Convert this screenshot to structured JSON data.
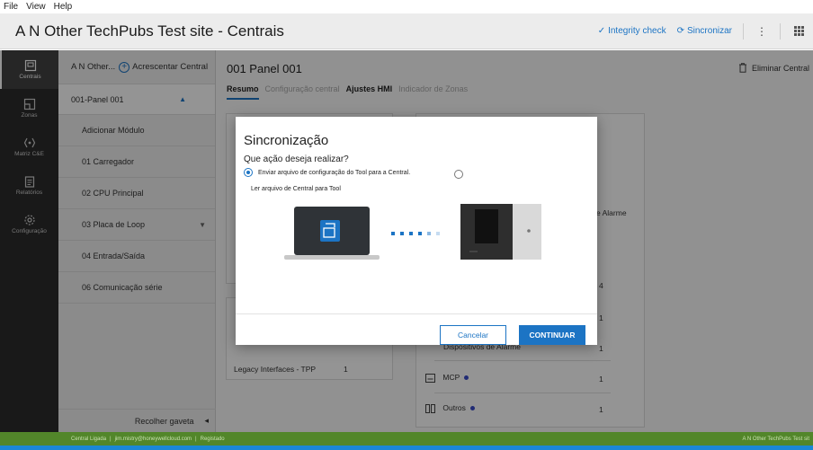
{
  "menubar": {
    "file": "File",
    "view": "View",
    "help": "Help"
  },
  "header": {
    "title": "A N Other TechPubs Test site -  Centrais",
    "integrity_check": "Integrity check",
    "sync": "Sincronizar"
  },
  "leftnav": {
    "items": [
      {
        "label": "Centrais",
        "icon": "panel-icon"
      },
      {
        "label": "Zonas",
        "icon": "zones-icon"
      },
      {
        "label": "Matriz C&E",
        "icon": "matrix-icon"
      },
      {
        "label": "Relatórios",
        "icon": "reports-icon"
      },
      {
        "label": "Configuração",
        "icon": "gear-icon"
      }
    ]
  },
  "drawer": {
    "site": "A N Other...",
    "add_panel": "Acrescentar Central",
    "panel": "001-Panel 001",
    "items": [
      "Adicionar Módulo",
      "01 Carregador",
      "02 CPU Principal",
      "03 Placa de Loop",
      "04 Entrada/Saída",
      "06 Comunicação série"
    ],
    "collapse": "Recolher gaveta"
  },
  "main": {
    "page_title": "001 Panel 001",
    "delete": "Eliminar Central",
    "tabs": [
      "Resumo",
      "Configuração central",
      "Ajustes HMI",
      "Indicador de Zonas"
    ],
    "alarm_label": "e Alarme",
    "legacy_label": "Legacy Interfaces - TPP",
    "legacy_value": "1",
    "value_4": "4",
    "value_1a": "1",
    "dispositivos": "Dispositivos de Alarme",
    "dispositivos_value": "1",
    "mcp": "MCP",
    "mcp_value": "1",
    "outros": "Outros",
    "outros_value": "1"
  },
  "statusbar": {
    "status": "Central Ligada",
    "user": "jim.mistry@honeywellcloud.com",
    "registered": "Registado",
    "site": "A N Other TechPubs Test sit"
  },
  "dialog": {
    "title": "Sincronização",
    "question": "Que ação deseja realizar?",
    "option1": "Enviar arquivo de configuração do Tool para a Central.",
    "option2": "Ler arquivo de Central para Tool",
    "cancel": "Cancelar",
    "continue": "CONTINUAR"
  },
  "colors": {
    "accent": "#1c74c4",
    "status_green": "#52862a",
    "nav_dark": "#2b2b2b"
  }
}
